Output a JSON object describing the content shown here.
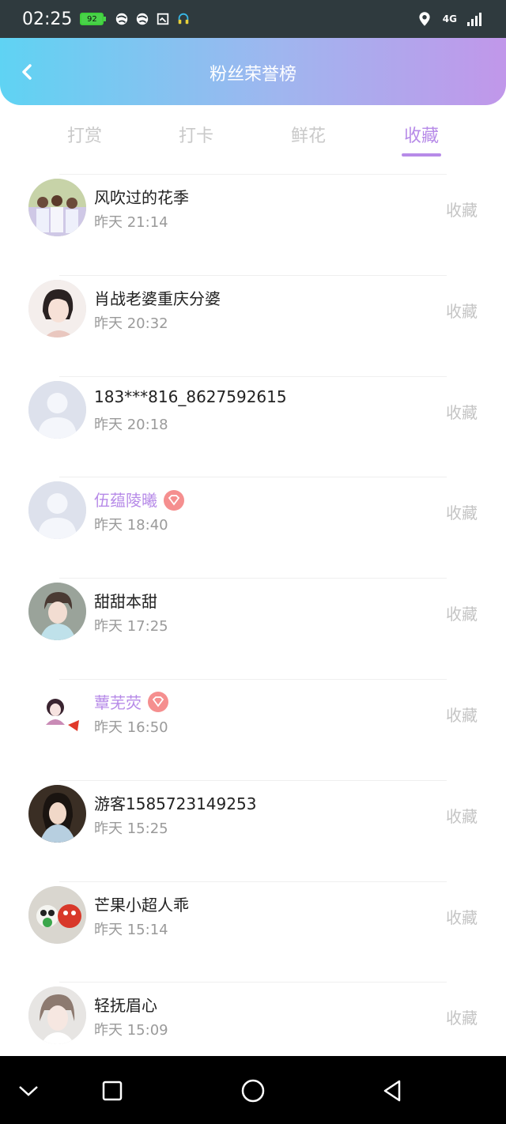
{
  "status_bar": {
    "time": "02:25",
    "battery": "92",
    "network": "4G"
  },
  "header": {
    "title": "粉丝荣誉榜"
  },
  "tabs": [
    {
      "label": "打赏",
      "active": false
    },
    {
      "label": "打卡",
      "active": false
    },
    {
      "label": "鲜花",
      "active": false
    },
    {
      "label": "收藏",
      "active": true
    }
  ],
  "list": [
    {
      "name": "风吹过的花季",
      "time": "昨天 21:14",
      "action": "收藏",
      "vip": false,
      "avatar": "group-photo"
    },
    {
      "name": "肖战老婆重庆分婆",
      "time": "昨天 20:32",
      "action": "收藏",
      "vip": false,
      "avatar": "girl-illustration"
    },
    {
      "name": "183***816_8627592615",
      "time": "昨天 20:18",
      "action": "收藏",
      "vip": false,
      "avatar": "default-user"
    },
    {
      "name": "伍蕴陵曦",
      "time": "昨天 18:40",
      "action": "收藏",
      "vip": true,
      "avatar": "default-user"
    },
    {
      "name": "甜甜本甜",
      "time": "昨天 17:25",
      "action": "收藏",
      "vip": false,
      "avatar": "boy-photo"
    },
    {
      "name": "蕈芜荧",
      "time": "昨天 16:50",
      "action": "收藏",
      "vip": true,
      "avatar": "cartoon-girl"
    },
    {
      "name": "游客1585723149253",
      "time": "昨天 15:25",
      "action": "收藏",
      "vip": false,
      "avatar": "costume-girl"
    },
    {
      "name": "芒果小超人乖",
      "time": "昨天 15:14",
      "action": "收藏",
      "vip": false,
      "avatar": "toys"
    },
    {
      "name": "轻抚眉心",
      "time": "昨天 15:09",
      "action": "收藏",
      "vip": false,
      "avatar": "girl-photo"
    }
  ],
  "colors": {
    "accent": "#b78be8",
    "header_start": "#5fd3f3",
    "header_end": "#c197ea",
    "vip_badge": "#f58f8f"
  },
  "icons": {
    "back": "chevron-left-icon",
    "nav": [
      "chevron-down-icon",
      "square-icon",
      "circle-icon",
      "triangle-back-icon"
    ]
  }
}
